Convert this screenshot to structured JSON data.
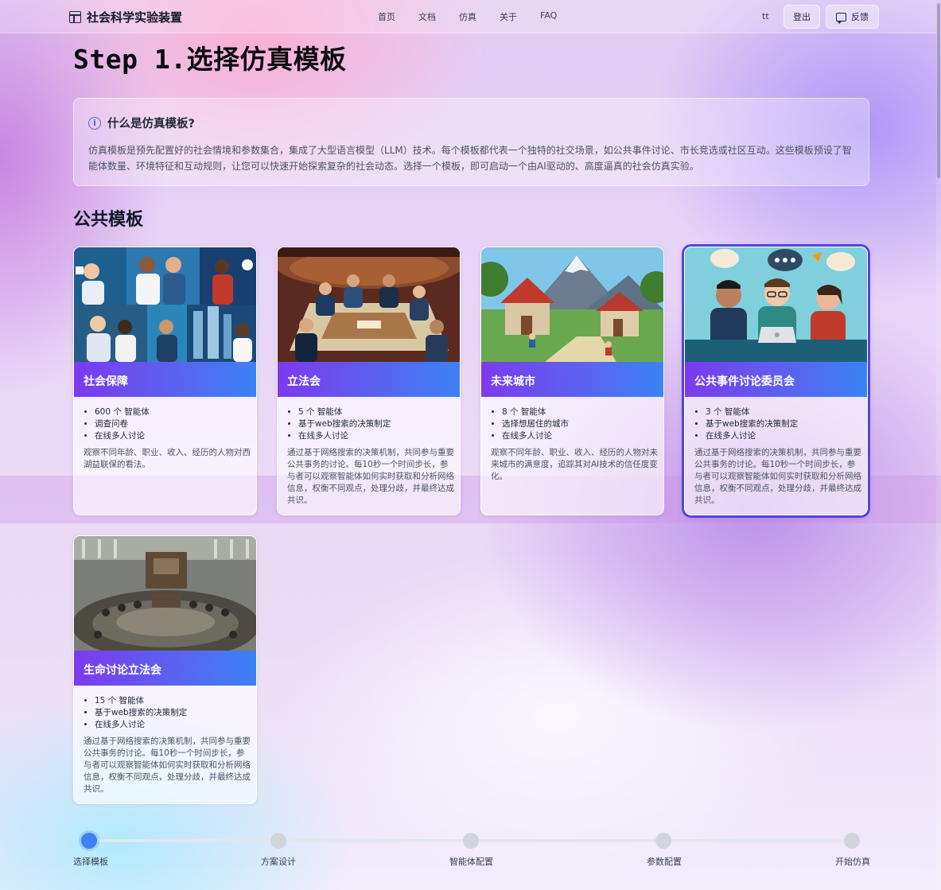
{
  "header": {
    "brand_title": "社会科学实验装置",
    "nav": [
      "首页",
      "文档",
      "仿真",
      "关于",
      "FAQ"
    ],
    "user_name": "tt",
    "logout_label": "登出",
    "feedback_label": "反馈"
  },
  "page": {
    "title_prefix": "Step 1.",
    "title_main": "选择仿真模板"
  },
  "info": {
    "title": "什么是仿真模板?",
    "text": "仿真模板是预先配置好的社会情境和参数集合，集成了大型语言模型（LLM）技术。每个模板都代表一个独特的社交场景，如公共事件讨论、市长竞选或社区互动。这些模板预设了智能体数量、环境特征和互动规则，让您可以快速开始探索复杂的社会动态。选择一个模板，即可启动一个由AI驱动的、高度逼真的社会仿真实验。"
  },
  "section_title": "公共模板",
  "templates": [
    {
      "title": "社会保障",
      "features": [
        "600 个 智能体",
        "调查问卷",
        "在线多人讨论"
      ],
      "description": "观察不同年龄、职业、收入、经历的人物对西湖益联保的看法。",
      "image": "social-security-illustration",
      "selected": false
    },
    {
      "title": "立法会",
      "features": [
        "5 个 智能体",
        "基于web搜索的决策制定",
        "在线多人讨论"
      ],
      "description": "通过基于网络搜索的决策机制，共同参与重要公共事务的讨论。每10秒一个时间步长，参与者可以观察智能体如何实时获取和分析网络信息，权衡不同观点，处理分歧，并最终达成共识。",
      "image": "legislative-council-illustration",
      "selected": false
    },
    {
      "title": "未来城市",
      "features": [
        "8 个 智能体",
        "选择想居住的城市",
        "在线多人讨论"
      ],
      "description": "观察不同年龄、职业、收入、经历的人物对未来城市的满意度，追踪其对AI技术的信任度变化。",
      "image": "future-city-illustration",
      "selected": false
    },
    {
      "title": "公共事件讨论委员会",
      "features": [
        "3 个 智能体",
        "基于web搜索的决策制定",
        "在线多人讨论"
      ],
      "description": "通过基于网络搜索的决策机制，共同参与重要公共事务的讨论。每10秒一个时间步长，参与者可以观察智能体如何实时获取和分析网络信息，权衡不同观点，处理分歧，并最终达成共识。",
      "image": "public-event-committee-illustration",
      "selected": true
    },
    {
      "title": "生命讨论立法会",
      "features": [
        "15 个 智能体",
        "基于web搜索的决策制定",
        "在线多人讨论"
      ],
      "description": "通过基于网络搜索的决策机制，共同参与重要公共事务的讨论。每10秒一个时间步长，参与者可以观察智能体如何实时获取和分析网络信息，权衡不同观点，处理分歧，并最终达成共识。",
      "image": "life-legislature-illustration",
      "selected": false
    }
  ],
  "steps": [
    {
      "label": "选择模板",
      "active": true
    },
    {
      "label": "方案设计",
      "active": false
    },
    {
      "label": "智能体配置",
      "active": false
    },
    {
      "label": "参数配置",
      "active": false
    },
    {
      "label": "开始仿真",
      "active": false
    }
  ],
  "colors": {
    "accent": "#3b82f6",
    "banner_start": "#7c3aed",
    "banner_end": "#3b82f6",
    "selected_border": "#5146d8"
  }
}
